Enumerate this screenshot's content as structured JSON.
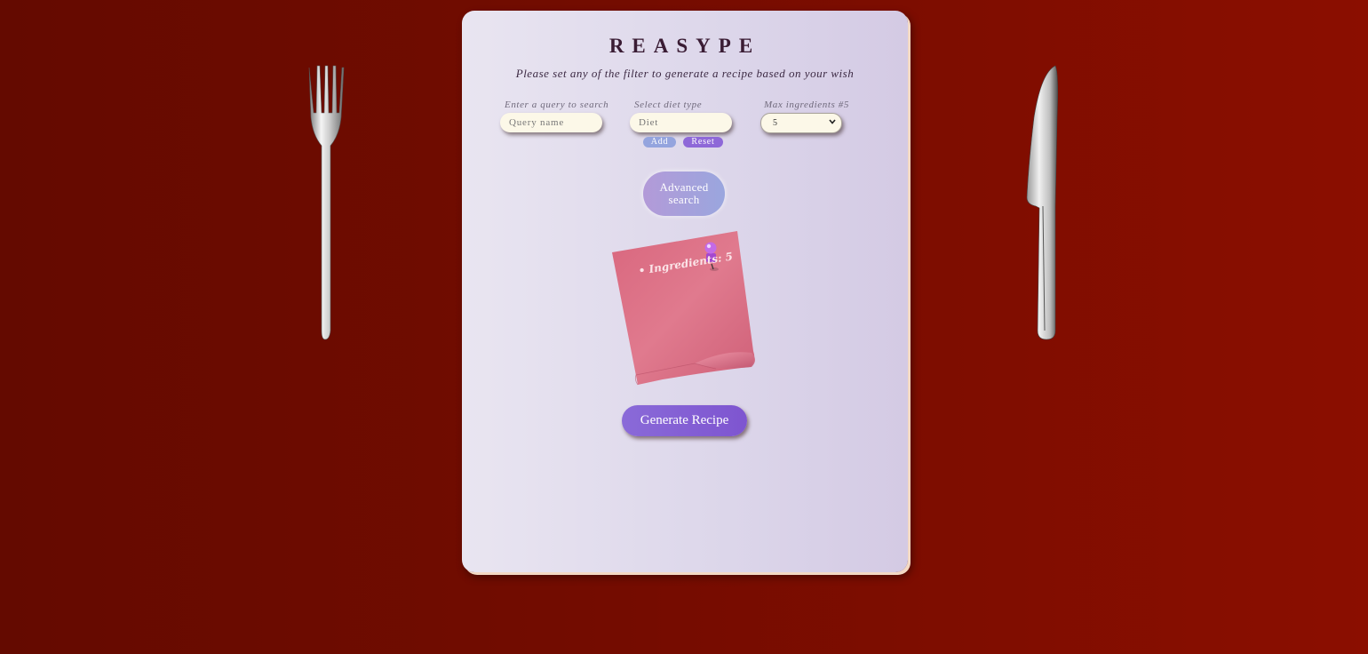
{
  "app": {
    "title": "REASYPE",
    "subtitle": "Please set any of the filter to generate a recipe based on your wish"
  },
  "filters": {
    "query_label": "Enter a query to search",
    "query_placeholder": "Query name",
    "diet_label": "Select diet type",
    "diet_placeholder": "Diet",
    "max_ingredients_label": "Max ingredients #5",
    "max_ingredients_value": "5"
  },
  "buttons": {
    "add": "Add",
    "reset": "Reset",
    "advanced_search": "Advanced search",
    "generate": "Generate Recipe"
  },
  "note": {
    "bullet": "•",
    "ingredients_text": "Ingredients: 5"
  },
  "colors": {
    "background": "#720c00",
    "card": "#e2ddec",
    "note": "#de7a8c",
    "accent": "#8a6ad8",
    "pin": "#b35ad8"
  },
  "icons": {
    "fork": "fork-icon",
    "knife": "knife-icon",
    "pin": "pushpin-icon",
    "select_arrow": "chevron-down-icon"
  }
}
